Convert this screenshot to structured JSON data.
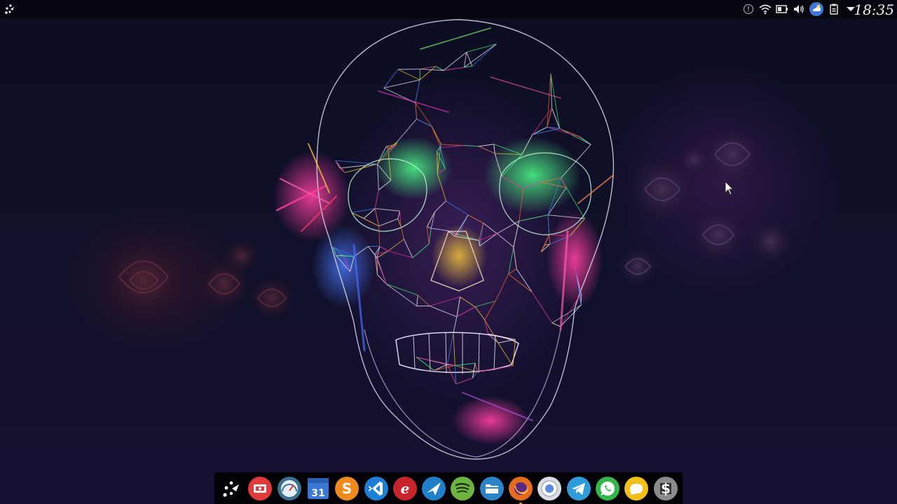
{
  "top_panel": {
    "launcher_icon": "app-launcher-icon",
    "tray": {
      "items": [
        {
          "name": "notification-icon"
        },
        {
          "name": "wifi-icon"
        },
        {
          "name": "battery-icon"
        },
        {
          "name": "volume-icon"
        },
        {
          "name": "weather-icon"
        },
        {
          "name": "clipboard-icon"
        },
        {
          "name": "menu-arrow-icon"
        }
      ],
      "clock": "18:35"
    }
  },
  "dock": {
    "items": [
      {
        "name": "launcher-icon",
        "color": "#ffffff"
      },
      {
        "name": "screen-recorder-icon",
        "color": "#e03a3a"
      },
      {
        "name": "system-monitor-icon",
        "color": "#3b6f8f"
      },
      {
        "name": "calendar-icon",
        "color": "#3a78d8",
        "badge": "31"
      },
      {
        "name": "sublime-text-icon",
        "color": "#f08a1e",
        "badge": "S"
      },
      {
        "name": "vscode-icon",
        "color": "#1f7fd6"
      },
      {
        "name": "text-editor-icon",
        "color": "#c8242b",
        "badge": "e"
      },
      {
        "name": "paper-plane-icon",
        "color": "#1f7fc8"
      },
      {
        "name": "spotify-icon",
        "color": "#6cb33f"
      },
      {
        "name": "file-manager-icon",
        "color": "#2b83c9"
      },
      {
        "name": "firefox-icon",
        "color": "#e66b1f",
        "running": true
      },
      {
        "name": "chrome-icon",
        "color": "#d8dde6"
      },
      {
        "name": "telegram-icon",
        "color": "#2f9bd8"
      },
      {
        "name": "whatsapp-icon",
        "color": "#33b749"
      },
      {
        "name": "chat-icon",
        "color": "#f2c01a"
      },
      {
        "name": "terminal-icon",
        "color": "#8b8b8b",
        "badge": "$"
      }
    ]
  },
  "wallpaper": {
    "accent_colors": [
      "#ff2ca0",
      "#3cff7a",
      "#3a8bff",
      "#ffd23a",
      "#ff6a2a"
    ]
  }
}
